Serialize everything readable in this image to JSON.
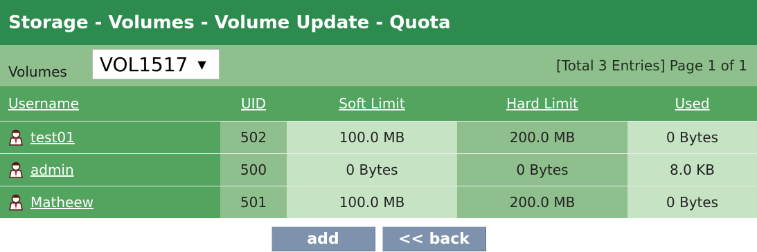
{
  "title": "Storage - Volumes - Volume Update - Quota",
  "toolbar": {
    "volumes_label": "Volumes",
    "volume_selected": "VOL1517",
    "page_info": "[Total 3 Entries] Page 1 of 1"
  },
  "columns": {
    "username": "Username",
    "uid": "UID",
    "soft_limit": "Soft Limit",
    "hard_limit": "Hard Limit",
    "used": "Used"
  },
  "rows": [
    {
      "username": "test01",
      "uid": "502",
      "soft_limit": "100.0 MB",
      "hard_limit": "200.0 MB",
      "used": "0 Bytes"
    },
    {
      "username": "admin",
      "uid": "500",
      "soft_limit": "0 Bytes",
      "hard_limit": "0 Bytes",
      "used": "8.0 KB"
    },
    {
      "username": "Matheew",
      "uid": "501",
      "soft_limit": "100.0 MB",
      "hard_limit": "200.0 MB",
      "used": "0 Bytes"
    }
  ],
  "buttons": {
    "add": "add",
    "back": "<< back"
  },
  "colors": {
    "title_bg": "#2e8b4f",
    "header_bg": "#53a45f",
    "toolbar_bg": "#8fbf8d",
    "light_cell": "#c6e3c3",
    "button_bg": "#7f92ad"
  },
  "icons": {
    "user": "user-icon",
    "dropdown": "chevron-down-icon"
  }
}
